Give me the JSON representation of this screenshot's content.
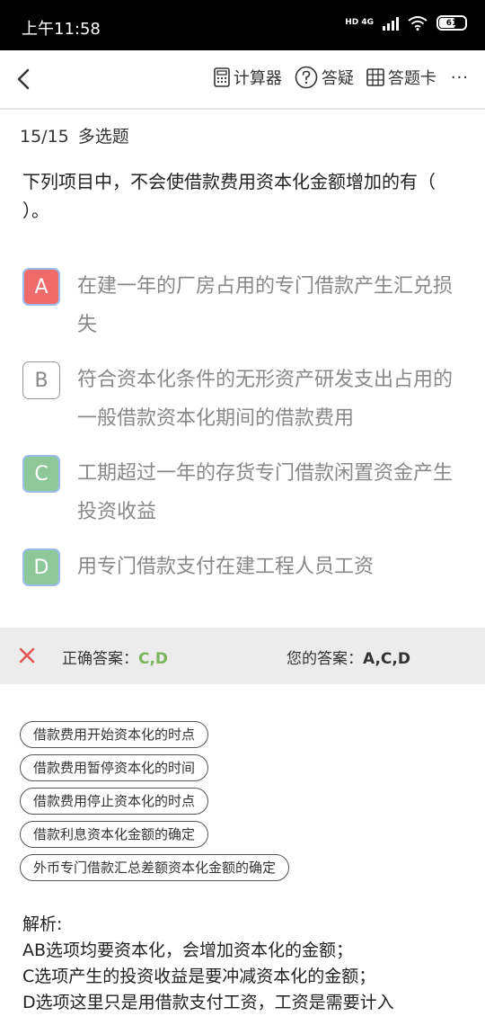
{
  "status_bar": {
    "time": "上午11:58",
    "network": "HD 4G",
    "battery": "61"
  },
  "toolbar": {
    "calculator_label": "计算器",
    "question_label": "答疑",
    "answer_card_label": "答题卡",
    "more_label": "···"
  },
  "question": {
    "progress": "15/15",
    "type": "多选题",
    "stem": "下列项目中，不会使借款费用资本化金额增加的有（    ）。"
  },
  "options": [
    {
      "letter": "A",
      "text": "在建一年的厂房占用的专门借款产生汇兑损失",
      "state": "wrong-selected"
    },
    {
      "letter": "B",
      "text": "符合资本化条件的无形资产研发支出占用的一般借款资本化期间的借款费用",
      "state": "unselected"
    },
    {
      "letter": "C",
      "text": "工期超过一年的存货专门借款闲置资金产生投资收益",
      "state": "correct"
    },
    {
      "letter": "D",
      "text": "用专门借款支付在建工程人员工资",
      "state": "correct"
    }
  ],
  "answer": {
    "correct_label": "正确答案：",
    "correct_value": "C,D",
    "yours_label": "您的答案：",
    "yours_value": "A,C,D"
  },
  "tags": [
    "借款费用开始资本化的时点",
    "借款费用暂停资本化的时间",
    "借款费用停止资本化的时点",
    "借款利息资本化金额的确定",
    "外币专门借款汇总差额资本化金额的确定"
  ],
  "analysis": {
    "title": "解析:",
    "lines": [
      "AB选项均要资本化，会增加资本化的金额；",
      "C选项产生的投资收益是要冲减资本化的金额；",
      "D选项这里只是用借款支付工资，工资是需要计入"
    ]
  },
  "colors": {
    "wrong": "#ef6b6b",
    "correct": "#8dc79a",
    "correct_text": "#7ab55c",
    "answer_bar_bg": "#ececec"
  }
}
